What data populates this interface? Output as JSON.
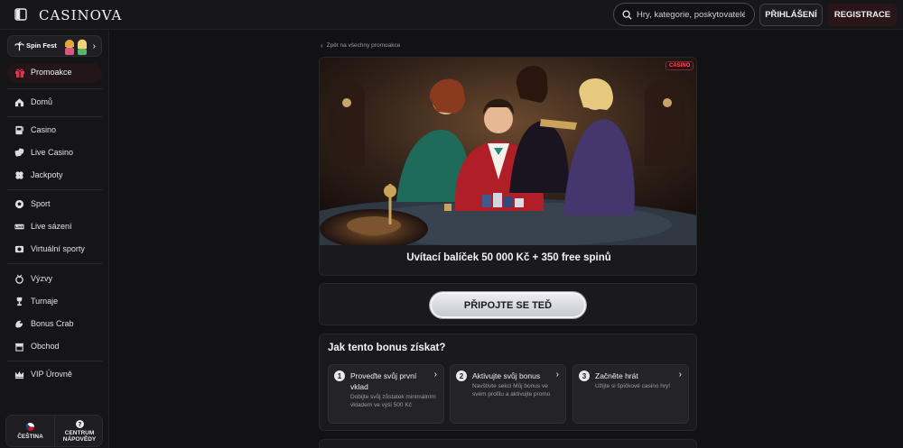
{
  "header": {
    "logo": "CASINOVA",
    "search_placeholder": "Hry, kategorie, poskytovatelé",
    "login_label": "PŘIHLÁŠENÍ",
    "register_label": "REGISTRACE"
  },
  "sidebar": {
    "spinfest_label": "Spin Fest",
    "promo_label": "Promoakce",
    "items": [
      {
        "label": "Domů",
        "icon": "home-icon"
      },
      {
        "label": "Casino",
        "icon": "slot-machine-icon"
      },
      {
        "label": "Live Casino",
        "icon": "dice-icon"
      },
      {
        "label": "Jackpoty",
        "icon": "clover-icon"
      },
      {
        "label": "Sport",
        "icon": "soccer-ball-icon"
      },
      {
        "label": "Live sázení",
        "icon": "live-icon"
      },
      {
        "label": "Virtuální sporty",
        "icon": "virtual-sports-icon"
      },
      {
        "label": "Výzvy",
        "icon": "medal-icon"
      },
      {
        "label": "Turnaje",
        "icon": "trophy-icon"
      },
      {
        "label": "Bonus Crab",
        "icon": "crab-claw-icon"
      },
      {
        "label": "Obchod",
        "icon": "shop-icon"
      },
      {
        "label": "VIP Úrovně",
        "icon": "crown-icon"
      }
    ],
    "language_label": "ČEŠTINA",
    "help_label_1": "CENTRUM",
    "help_label_2": "NÁPOVĚDY"
  },
  "main": {
    "back_link": "Zpět na všechny promoakce",
    "hero_tag": "CASINO",
    "hero_title": "Uvítací balíček 50 000 Kč + 350 free spinů",
    "join_button": "PŘIPOJTE SE TEĎ",
    "how_title": "Jak tento bonus získat?",
    "steps": [
      {
        "num": "1",
        "title": "Proveďte svůj první vklad",
        "desc": "Dobijte svůj zůstatek minimálním vkladem ve výši 500 Kč"
      },
      {
        "num": "2",
        "title": "Aktivujte svůj bonus",
        "desc": "Navštivte sekci Můj bonus ve svém profilu a aktivujte promo"
      },
      {
        "num": "3",
        "title": "Začněte hrát",
        "desc": "Užijte si špičkové casino hry!"
      }
    ]
  },
  "colors": {
    "background": "#121214",
    "card": "#1a1a1e",
    "accent_red": "#ff4d5e",
    "register_bg": "#2a1619"
  }
}
